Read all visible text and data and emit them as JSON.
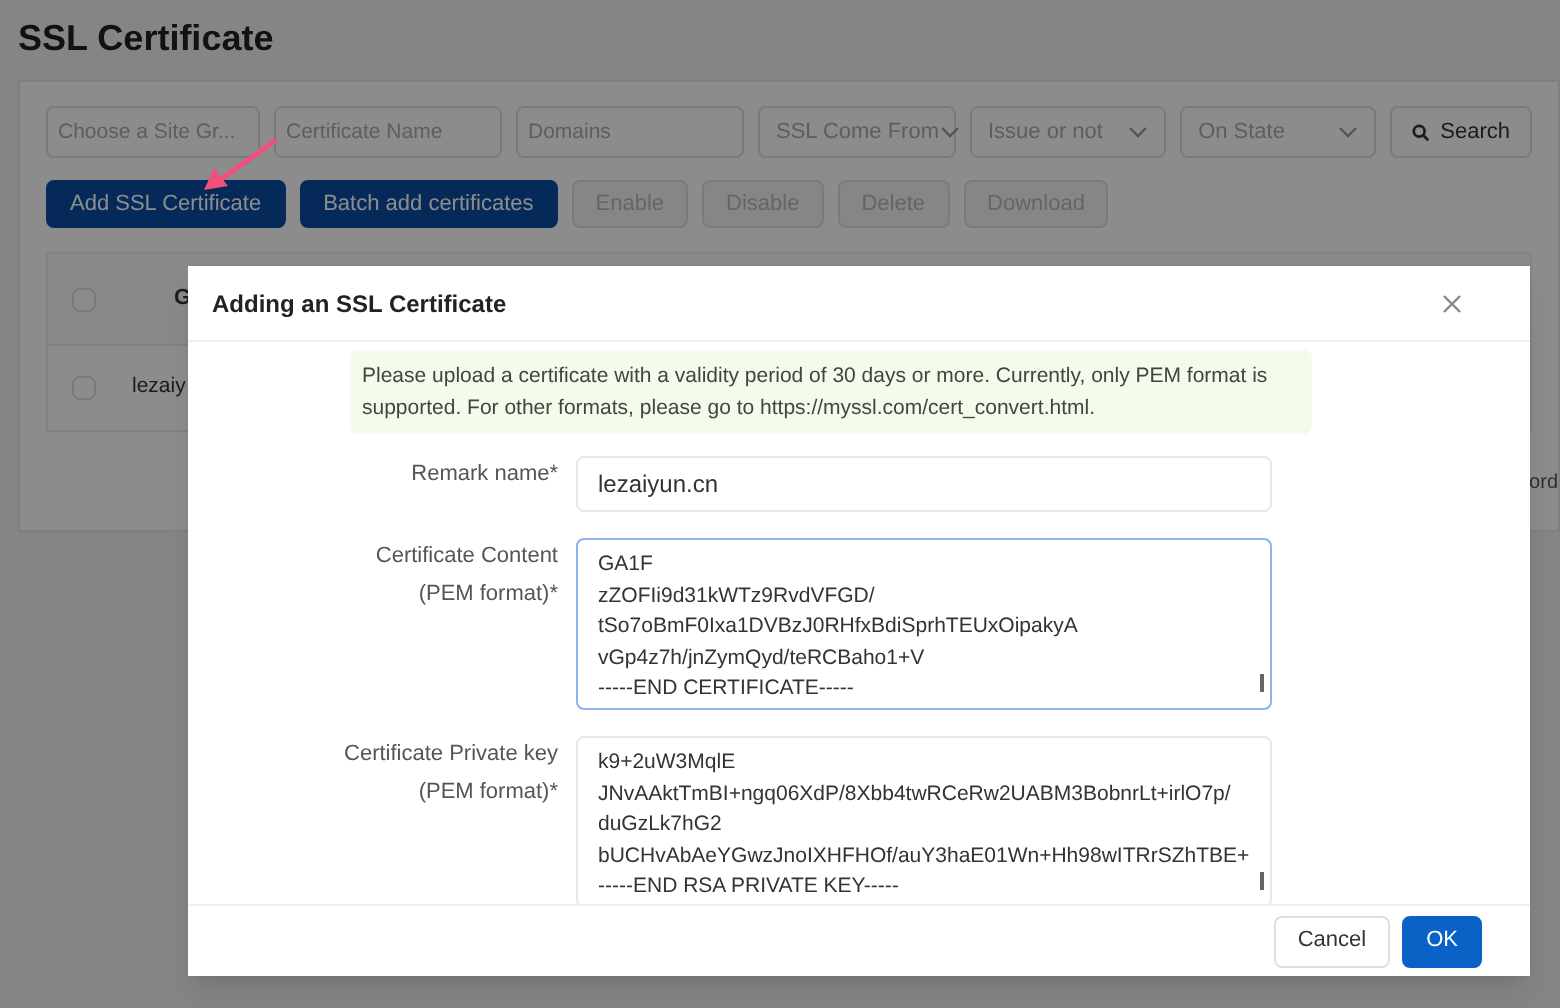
{
  "page": {
    "title": "SSL Certificate"
  },
  "filters": [
    {
      "kind": "input",
      "placeholder": "Choose a Site Gr..."
    },
    {
      "kind": "input",
      "placeholder": "Certificate Name"
    },
    {
      "kind": "input",
      "placeholder": "Domains"
    },
    {
      "kind": "select",
      "placeholder": "SSL Come From"
    },
    {
      "kind": "select",
      "placeholder": "Issue or not"
    },
    {
      "kind": "select",
      "placeholder": "On State"
    }
  ],
  "search_button": "Search",
  "actions": [
    {
      "label": "Add SSL Certificate",
      "disabled": false
    },
    {
      "label": "Batch add certificates",
      "disabled": false
    },
    {
      "label": "Enable",
      "disabled": true
    },
    {
      "label": "Disable",
      "disabled": true
    },
    {
      "label": "Delete",
      "disabled": true
    },
    {
      "label": "Download",
      "disabled": true
    }
  ],
  "table": {
    "header": "G",
    "row_cell": "lezaiy",
    "right_text": "ord",
    "header_checked": false,
    "row_checked": false
  },
  "dialog": {
    "title": "Adding an SSL Certificate",
    "notice": "Please upload a certificate with a validity period of 30 days or more. Currently, only PEM format is supported. For other formats, please go to https://myssl.com/cert_convert.html.",
    "fields": [
      {
        "kind": "input",
        "label": "Remark name*",
        "value": "lezaiyun.cn"
      },
      {
        "kind": "textarea",
        "label": "Certificate Content (PEM format)*",
        "focused": true,
        "lines": [
          "GA1F",
          "zZOFIi9d31kWTz9RvdVFGD/",
          "tSo7oBmF0Ixa1DVBzJ0RHfxBdiSprhTEUxOipakyA",
          "vGp4z7h/jnZymQyd/teRCBaho1+V",
          "-----END CERTIFICATE-----"
        ]
      },
      {
        "kind": "textarea",
        "label": "Certificate Private key (PEM format)*",
        "focused": false,
        "lines": [
          "k9+2uW3MqlE",
          "JNvAAktTmBI+ngq06XdP/8Xbb4twRCeRw2UABM3BobnrLt+irlO7p/",
          "duGzLk7hG2",
          "bUCHvAbAeYGwzJnoIXHFHOf/auY3haE01Wn+Hh98wITRrSZhTBE+",
          "-----END RSA PRIVATE KEY-----"
        ]
      }
    ],
    "buttons": [
      {
        "label": "Cancel",
        "kind": "secondary"
      },
      {
        "label": "OK",
        "kind": "primary"
      }
    ]
  }
}
